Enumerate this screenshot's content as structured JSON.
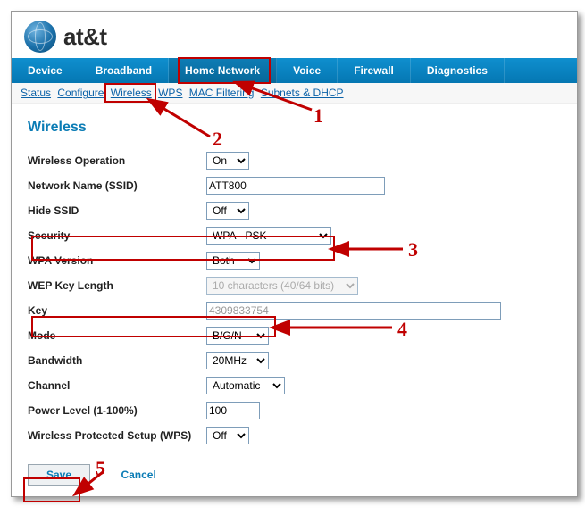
{
  "brand": "at&t",
  "tabs": [
    "Device",
    "Broadband",
    "Home Network",
    "Voice",
    "Firewall",
    "Diagnostics"
  ],
  "active_tab": 2,
  "subnav": [
    "Status",
    "Configure",
    "Wireless",
    "WPS",
    "MAC Filtering",
    "Subnets & DHCP"
  ],
  "section_title": "Wireless",
  "fields": {
    "wireless_operation": {
      "label": "Wireless Operation",
      "value": "On"
    },
    "ssid": {
      "label": "Network Name (SSID)",
      "value": "ATT800"
    },
    "hide_ssid": {
      "label": "Hide SSID",
      "value": "Off"
    },
    "security": {
      "label": "Security",
      "value": "WPA - PSK"
    },
    "wpa_version": {
      "label": "WPA Version",
      "value": "Both"
    },
    "wep_key_length": {
      "label": "WEP Key Length",
      "value": "10 characters (40/64 bits)"
    },
    "key": {
      "label": "Key",
      "value": "4309833754"
    },
    "mode": {
      "label": "Mode",
      "value": "B/G/N"
    },
    "bandwidth": {
      "label": "Bandwidth",
      "value": "20MHz"
    },
    "channel": {
      "label": "Channel",
      "value": "Automatic"
    },
    "power": {
      "label": "Power Level (1-100%)",
      "value": "100"
    },
    "wps": {
      "label": "Wireless Protected Setup (WPS)",
      "value": "Off"
    }
  },
  "buttons": {
    "save": "Save",
    "cancel": "Cancel"
  },
  "annotations": {
    "n1": "1",
    "n2": "2",
    "n3": "3",
    "n4": "4",
    "n5": "5"
  }
}
